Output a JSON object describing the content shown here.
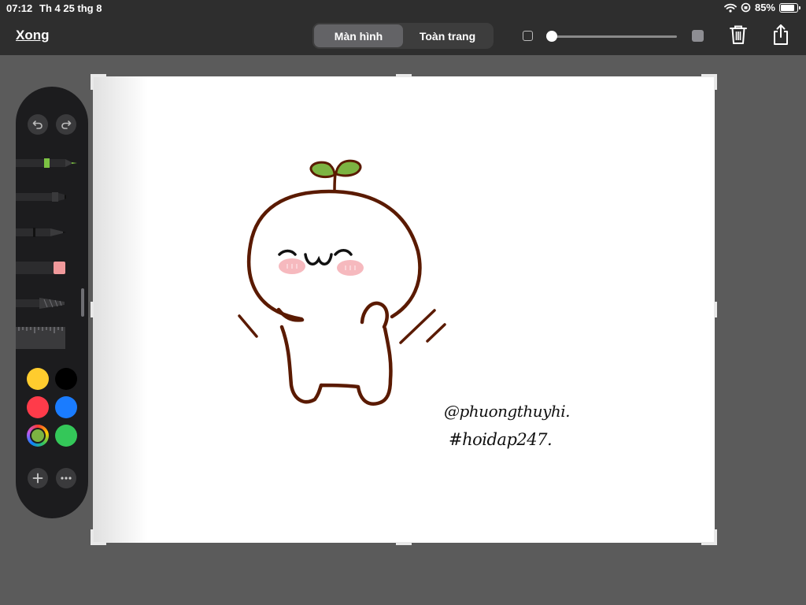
{
  "status_bar": {
    "time": "07:12",
    "date": "Th 4 25 thg 8",
    "battery_percent": "85%",
    "battery_level": 0.85
  },
  "toolbar": {
    "done_label": "Xong",
    "segments": [
      {
        "label": "Màn hình",
        "selected": true
      },
      {
        "label": "Toàn trang",
        "selected": false
      }
    ],
    "size_slider_value": 0.0,
    "trash_icon": "trash-icon",
    "share_icon": "share-icon"
  },
  "palette": {
    "undo_icon": "undo-icon",
    "redo_icon": "redo-icon",
    "tools": [
      "pen",
      "marker",
      "pencil",
      "eraser",
      "lasso",
      "ruler"
    ],
    "colors": [
      "#ffcc2e",
      "#000000",
      "#ff3b4a",
      "#1a7cff",
      "color-picker",
      "#34c759"
    ],
    "add_icon": "plus-icon",
    "more_icon": "ellipsis-icon"
  },
  "canvas": {
    "caption_line1": "@phuongthuyhi.",
    "caption_line2": "#hoidap247.",
    "drawing_colors": {
      "outline": "#5a1a00",
      "leaf": "#7cb342",
      "blush": "#f6b9be"
    }
  }
}
